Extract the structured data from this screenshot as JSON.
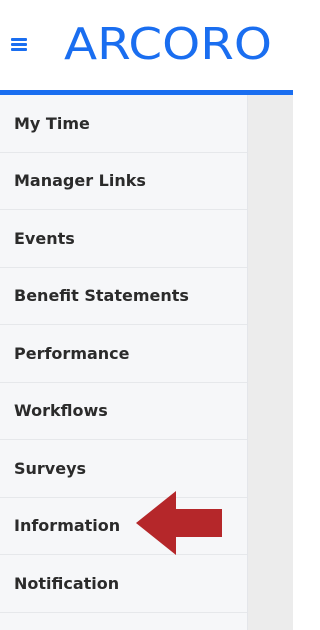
{
  "header": {
    "logo_text": "ARCORO",
    "brand_color": "#1a6ef0"
  },
  "icons": {
    "menu": "hamburger-icon",
    "annotation": "left-arrow-icon"
  },
  "annotation": {
    "color": "#b5272a",
    "target": "Information"
  },
  "sidebar": {
    "items": [
      {
        "label": "My Time"
      },
      {
        "label": "Manager Links"
      },
      {
        "label": "Events"
      },
      {
        "label": "Benefit Statements"
      },
      {
        "label": "Performance"
      },
      {
        "label": "Workflows"
      },
      {
        "label": "Surveys"
      },
      {
        "label": "Information"
      },
      {
        "label": "Notification"
      }
    ]
  }
}
